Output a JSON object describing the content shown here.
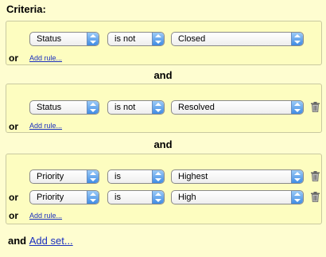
{
  "title": "Criteria:",
  "connector_label": "and",
  "or_label": "or",
  "add_rule_label": "Add rule...",
  "footer": {
    "and_label": "and",
    "add_set_label": "Add set..."
  },
  "sets": [
    {
      "rules": [
        {
          "field": "Status",
          "operator": "is not",
          "value": "Closed"
        }
      ]
    },
    {
      "rules": [
        {
          "field": "Status",
          "operator": "is not",
          "value": "Resolved"
        }
      ]
    },
    {
      "rules": [
        {
          "field": "Priority",
          "operator": "is",
          "value": "Highest"
        },
        {
          "field": "Priority",
          "operator": "is",
          "value": "High"
        }
      ]
    }
  ],
  "icons": {
    "select_arrows": "updown-arrows-icon",
    "delete": "trash-icon"
  }
}
